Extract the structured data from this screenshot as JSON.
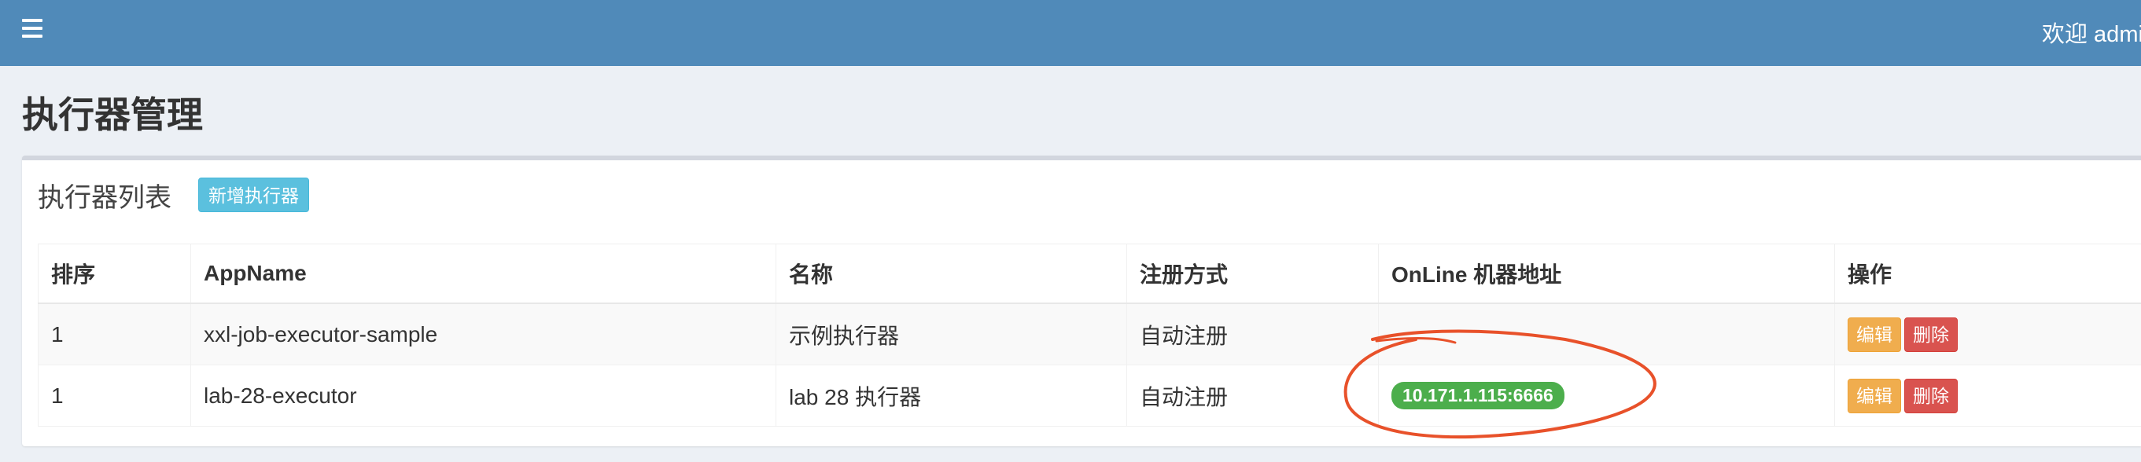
{
  "header": {
    "welcome_text": "欢迎 admi"
  },
  "page": {
    "title": "执行器管理"
  },
  "box": {
    "title": "执行器列表",
    "add_button_label": "新增执行器"
  },
  "table": {
    "columns": [
      "排序",
      "AppName",
      "名称",
      "注册方式",
      "OnLine 机器地址",
      "操作"
    ],
    "rows": [
      {
        "order": "1",
        "app_name": "xxl-job-executor-sample",
        "name": "示例执行器",
        "registry_type": "自动注册",
        "online_address": "",
        "edit_label": "编辑",
        "delete_label": "删除"
      },
      {
        "order": "1",
        "app_name": "lab-28-executor",
        "name": "lab 28 执行器",
        "registry_type": "自动注册",
        "online_address": "10.171.1.115:6666",
        "edit_label": "编辑",
        "delete_label": "删除"
      }
    ]
  },
  "colors": {
    "header_bg": "#508ab9",
    "online_badge": "#4cae4c",
    "edit_button": "#f0ad4e",
    "delete_button": "#d9534f",
    "annotation": "#e8512a"
  }
}
